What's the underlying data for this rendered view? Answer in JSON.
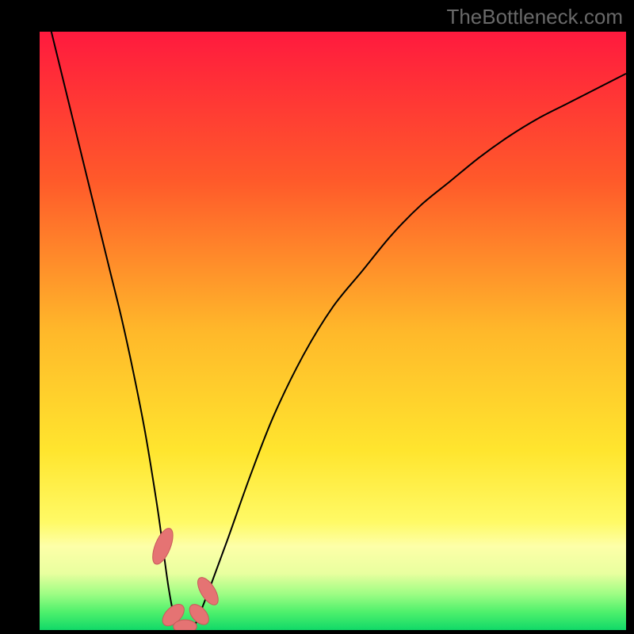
{
  "watermark": "TheBottleneck.com",
  "colors": {
    "gradient_stops": [
      {
        "offset": 0.0,
        "color": "#ff1a3e"
      },
      {
        "offset": 0.25,
        "color": "#ff5a2a"
      },
      {
        "offset": 0.5,
        "color": "#ffb82a"
      },
      {
        "offset": 0.7,
        "color": "#ffe52e"
      },
      {
        "offset": 0.82,
        "color": "#fffa66"
      },
      {
        "offset": 0.86,
        "color": "#fdffa8"
      },
      {
        "offset": 0.905,
        "color": "#e9ff9f"
      },
      {
        "offset": 0.94,
        "color": "#9dfd84"
      },
      {
        "offset": 0.97,
        "color": "#4ef06c"
      },
      {
        "offset": 1.0,
        "color": "#11d968"
      }
    ],
    "curve": "#000000",
    "marker_fill": "#e57373",
    "marker_stroke": "#c85a5a"
  },
  "chart_data": {
    "type": "line",
    "title": "",
    "xlabel": "",
    "ylabel": "",
    "xlim": [
      0,
      100
    ],
    "ylim": [
      0,
      100
    ],
    "series": [
      {
        "name": "bottleneck-curve",
        "x": [
          0,
          2,
          4,
          6,
          8,
          10,
          12,
          14,
          16,
          18,
          20,
          21,
          22,
          23,
          24,
          25,
          26,
          27,
          29,
          32,
          36,
          40,
          45,
          50,
          55,
          60,
          65,
          70,
          75,
          80,
          85,
          90,
          95,
          100
        ],
        "y": [
          108,
          100,
          92,
          84,
          76,
          68,
          60,
          52,
          43,
          33,
          21,
          14,
          7,
          2,
          0,
          0,
          0,
          2,
          7,
          15,
          26,
          36,
          46,
          54,
          60,
          66,
          71,
          75,
          79,
          82.5,
          85.5,
          88,
          90.5,
          93
        ]
      }
    ],
    "markers": [
      {
        "x": 21.0,
        "y": 14.0,
        "rx": 1.3,
        "ry": 3.2,
        "rot": 22
      },
      {
        "x": 22.8,
        "y": 2.5,
        "rx": 1.3,
        "ry": 2.2,
        "rot": 45
      },
      {
        "x": 24.8,
        "y": 0.6,
        "rx": 2.0,
        "ry": 1.1,
        "rot": 0
      },
      {
        "x": 27.2,
        "y": 2.6,
        "rx": 1.2,
        "ry": 2.0,
        "rot": -42
      },
      {
        "x": 28.7,
        "y": 6.5,
        "rx": 1.2,
        "ry": 2.6,
        "rot": -32
      }
    ]
  }
}
